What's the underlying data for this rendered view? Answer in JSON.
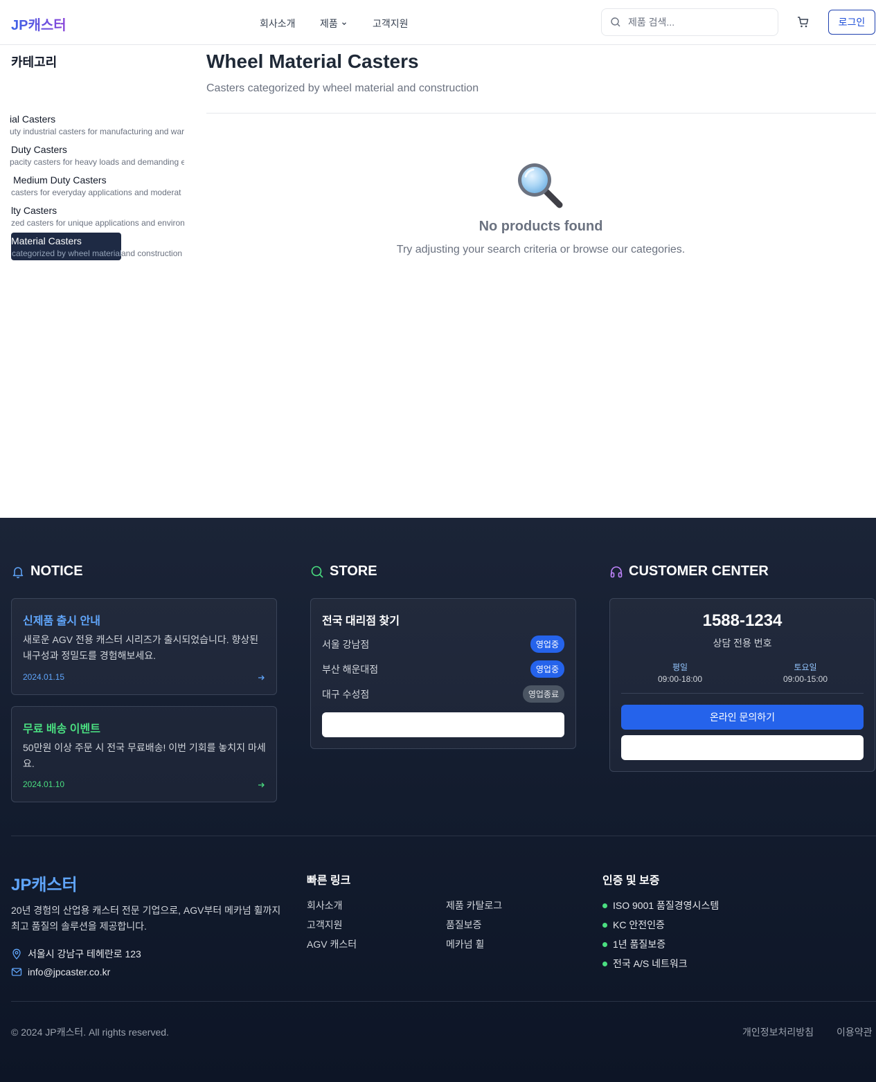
{
  "header": {
    "logo": "JP캐스터",
    "nav": {
      "about": "회사소개",
      "products": "제품",
      "support": "고객지원"
    },
    "search_placeholder": "제품 검색...",
    "login": "로그인"
  },
  "sidebar": {
    "title": "카테고리",
    "items": [
      {
        "name": "ial Casters",
        "desc": "uty industrial casters for manufacturing and war"
      },
      {
        "name": "Duty Casters",
        "desc": "pacity casters for heavy loads and demanding e"
      },
      {
        "name": "Medium Duty Casters",
        "desc": "casters for everyday applications and moderat"
      },
      {
        "name": "lty Casters",
        "desc": "zed casters for unique applications and environ"
      },
      {
        "name": "Material Casters",
        "desc_a": "categorized by wheel material",
        "desc_b": " and construction",
        "active": true
      }
    ]
  },
  "main": {
    "title": "Wheel Material Casters",
    "subtitle": "Casters categorized by wheel material and construction",
    "empty_title": "No products found",
    "empty_text": "Try adjusting your search criteria or browse our categories."
  },
  "footer": {
    "notice": {
      "heading": "NOTICE",
      "items": [
        {
          "title": "신제품 출시 안내",
          "body": "새로운 AGV 전용 캐스터 시리즈가 출시되었습니다. 향상된 내구성과 정밀도를 경험해보세요.",
          "date": "2024.01.15",
          "color": "#60a5fa"
        },
        {
          "title": "무료 배송 이벤트",
          "body": "50만원 이상 주문 시 전국 무료배송! 이번 기회를 놓치지 마세요.",
          "date": "2024.01.10",
          "color": "#4ade80"
        }
      ]
    },
    "store": {
      "heading": "STORE",
      "title": "전국 대리점 찾기",
      "rows": [
        {
          "name": "서울 강남점",
          "status": "영업중",
          "open": true
        },
        {
          "name": "부산 해운대점",
          "status": "영업중",
          "open": true
        },
        {
          "name": "대구 수성점",
          "status": "영업종료",
          "open": false
        }
      ]
    },
    "customer": {
      "heading": "CUSTOMER CENTER",
      "phone": "1588-1234",
      "phone_sub": "상담 전용 번호",
      "weekday_label": "평일",
      "weekday_time": "09:00-18:00",
      "saturday_label": "토요일",
      "saturday_time": "09:00-15:00",
      "inquiry_button": "온라인 문의하기"
    },
    "brand": {
      "logo": "JP캐스터",
      "desc": "20년 경험의 산업용 캐스터 전문 기업으로, AGV부터 메카넘 휠까지 최고 품질의 솔루션을 제공합니다.",
      "address": "서울시 강남구 테헤란로 123",
      "email": "info@jpcaster.co.kr"
    },
    "quick_links": {
      "title": "빠른 링크",
      "col1": [
        "회사소개",
        "고객지원",
        "AGV 캐스터"
      ],
      "col2": [
        "제품 카탈로그",
        "품질보증",
        "메카넘 휠"
      ]
    },
    "certs": {
      "title": "인증 및 보증",
      "items": [
        "ISO 9001 품질경영시스템",
        "KC 안전인증",
        "1년 품질보증",
        "전국 A/S 네트워크"
      ]
    },
    "copyright": "© 2024 JP캐스터. All rights reserved.",
    "privacy": "개인정보처리방침",
    "terms": "이용약관"
  }
}
